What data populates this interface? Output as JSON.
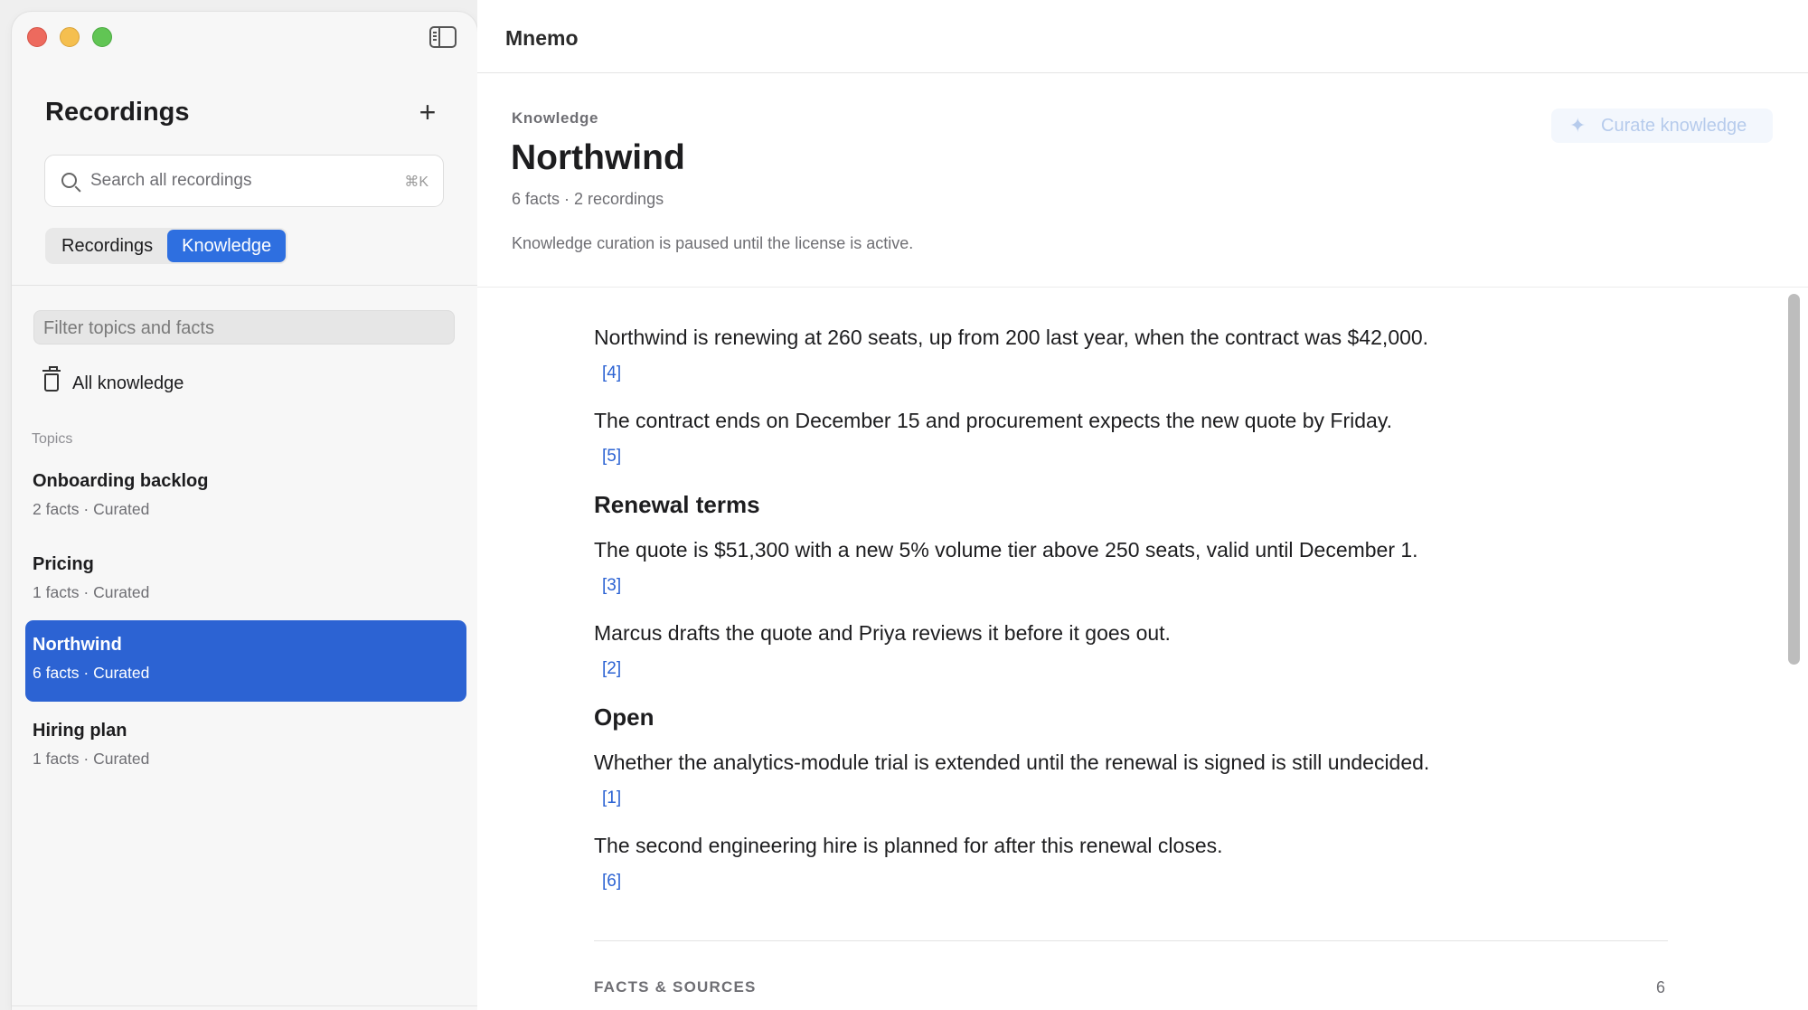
{
  "window": {
    "app_title": "Mnemo"
  },
  "sidebar": {
    "title": "Recordings",
    "add_label": "+",
    "search": {
      "placeholder": "Search all recordings",
      "shortcut": "⌘K"
    },
    "segments": [
      {
        "label": "Recordings",
        "active": false
      },
      {
        "label": "Knowledge",
        "active": true
      }
    ],
    "filter_placeholder": "Filter topics and facts",
    "all_knowledge_label": "All knowledge",
    "topics_heading": "Topics",
    "topics": [
      {
        "name": "Onboarding backlog",
        "meta": "2 facts · Curated",
        "selected": false
      },
      {
        "name": "Pricing",
        "meta": "1 facts · Curated",
        "selected": false
      },
      {
        "name": "Northwind",
        "meta": "6 facts · Curated",
        "selected": true
      },
      {
        "name": "Hiring plan",
        "meta": "1 facts · Curated",
        "selected": false
      }
    ]
  },
  "main": {
    "kicker": "Knowledge",
    "heading": "Northwind",
    "subline": "6 facts · 2 recordings",
    "notice": "Knowledge curation is paused until the license is active.",
    "curate_button": "Curate knowledge",
    "facts": [
      {
        "text": "Northwind is renewing at 260 seats, up from 200 last year, when the contract was $42,000.",
        "cite": "[4]"
      },
      {
        "text": "The contract ends on December 15 and procurement expects the new quote by Friday.",
        "cite": "[5]"
      }
    ],
    "sections": [
      {
        "title": "Renewal terms",
        "facts": [
          {
            "text": "The quote is $51,300 with a new 5% volume tier above 250 seats, valid until December 1.",
            "cite": "[3]"
          },
          {
            "text": "Marcus drafts the quote and Priya reviews it before it goes out.",
            "cite": "[2]"
          }
        ]
      },
      {
        "title": "Open",
        "facts": [
          {
            "text": "Whether the analytics-module trial is extended until the renewal is signed is still undecided.",
            "cite": "[1]"
          },
          {
            "text": "The second engineering hire is planned for after this renewal closes.",
            "cite": "[6]"
          }
        ]
      }
    ],
    "facts_sources_label": "FACTS & SOURCES",
    "facts_sources_count": "6"
  },
  "colors": {
    "accent": "#2c63d3",
    "selected_row": "#2c63d3",
    "tl_close": "#ed6a5e",
    "tl_min": "#f5bf4f",
    "tl_max": "#61c554"
  }
}
